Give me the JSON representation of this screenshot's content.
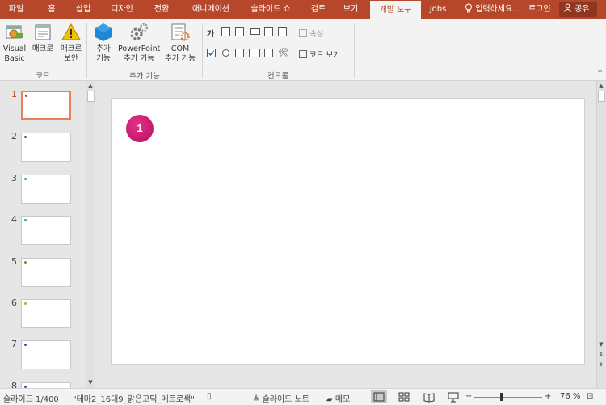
{
  "tabs": [
    "파일",
    "홈",
    "삽입",
    "디자인",
    "전환",
    "애니메이션",
    "슬라이드 쇼",
    "검토",
    "보기",
    "개발 도구",
    "Jobs"
  ],
  "active_tab": "개발 도구",
  "search_placeholder": "입력하세요...",
  "login_label": "로그인",
  "share_label": "공유",
  "ribbon": {
    "code": {
      "visual_basic": [
        "Visual",
        "Basic"
      ],
      "macro": "매크로",
      "macro_security": [
        "매크로",
        "보안"
      ],
      "label": "코드"
    },
    "addins": {
      "addins": [
        "추가",
        "기능"
      ],
      "powerpoint_addins": [
        "PowerPoint",
        "추가 기능"
      ],
      "com_addins": [
        "COM",
        "추가 기능"
      ],
      "label": "추가 기능"
    },
    "controls": {
      "label_glyph": "가",
      "properties": "속성",
      "view_code": "코드 보기",
      "label": "컨트롤"
    }
  },
  "slides": [
    {
      "num": "1",
      "dot": "#c0306c"
    },
    {
      "num": "2",
      "dot": "#5a3fa0"
    },
    {
      "num": "3",
      "dot": "#2aa58c"
    },
    {
      "num": "4",
      "dot": "#2aa5a5"
    },
    {
      "num": "5",
      "dot": "#a07830"
    },
    {
      "num": "6",
      "dot": "#b0b030"
    },
    {
      "num": "7",
      "dot": "#5a3fa0"
    },
    {
      "num": "8",
      "dot": "#5a3fa0"
    }
  ],
  "current_slide": {
    "badge": "1"
  },
  "status": {
    "slide_count": "슬라이드 1/400",
    "theme": "\"테마2_16대9_맑은고딕_메트로색\"",
    "notes": "슬라이드 노트",
    "comments": "메모",
    "zoom": "76 %"
  },
  "colors": {
    "accent": "#b7472a",
    "badge": "#d4186f"
  }
}
